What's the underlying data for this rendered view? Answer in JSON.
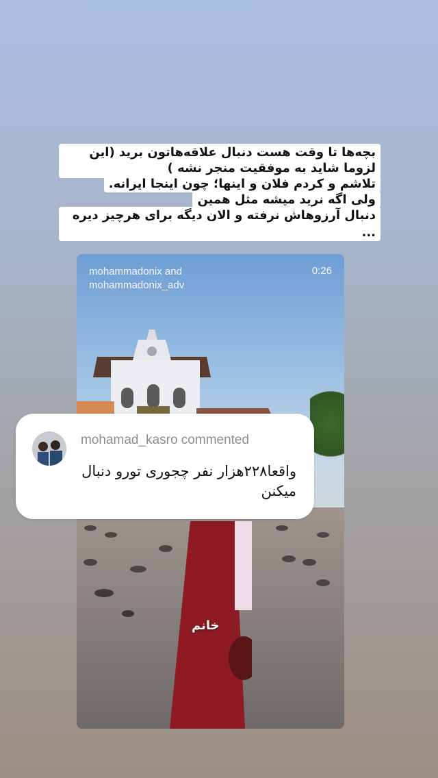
{
  "story": {
    "caption_lines": [
      "بچه‌ها تا وقت هست دنبال علاقه‌هاتون برید (این رفتن",
      "لزوما شاید به موفقیت منجر نشه )",
      "تلاشم و کردم فلان و اینها؛ چون اینجا ایرانه.",
      "ولی اگه نرید میشه مثل همین",
      "دنبال آرزوهاش نرفته و الان دیگه برای هرچیز دیره ..."
    ]
  },
  "video": {
    "handle": "mohammadonix and\nmohammadonix_adv",
    "handle_line1": "mohammadonix and",
    "handle_line2": "mohammadonix_adv",
    "duration": "0:26",
    "sticker_text": "خانم"
  },
  "comment": {
    "username_line": "mohamad_kasro commented",
    "text": "واقعا۲۲۸هزار نفر چجوری تورو دنبال میکنن"
  },
  "colors": {
    "background_top": "#a9bfe0",
    "background_bottom": "#9d8e84",
    "dress": "#8e1a24"
  }
}
